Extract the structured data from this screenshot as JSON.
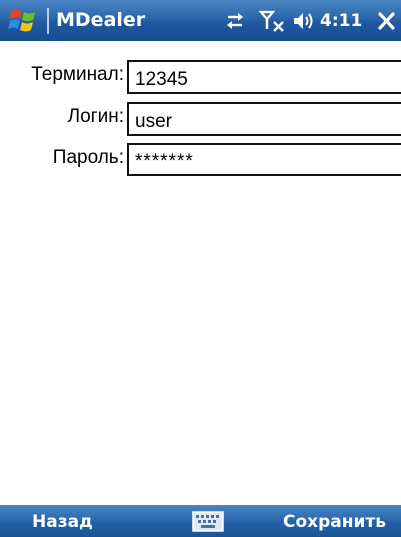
{
  "titlebar": {
    "app_title": "MDealer",
    "clock": "4:11",
    "icons": [
      "windows-start-icon",
      "sync-icon",
      "signal-off-icon",
      "volume-icon",
      "close-icon"
    ]
  },
  "form": {
    "terminal": {
      "label": "Терминал:",
      "value": "12345"
    },
    "login": {
      "label": "Логин:",
      "value": "user"
    },
    "password": {
      "label": "Пароль:",
      "value": "*******"
    }
  },
  "menubar": {
    "left_softkey": "Назад",
    "right_softkey": "Сохранить",
    "center_icon": "keyboard-icon"
  },
  "colors": {
    "bar_blue": "#2a66aa",
    "text": "#000000",
    "bar_text": "#ffffff"
  }
}
